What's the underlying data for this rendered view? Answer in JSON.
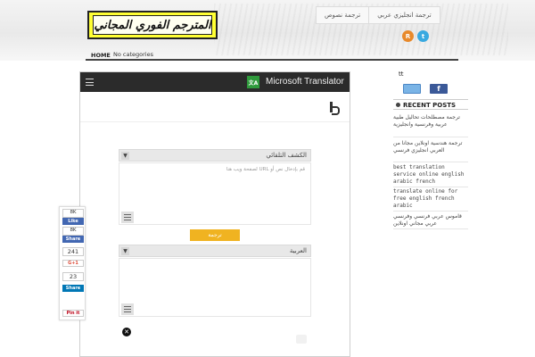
{
  "header": {
    "logo_text": "المترجم الفوري المجاني",
    "nav": [
      "ترجمة نصوص",
      "ترجمة انجليزي عربي"
    ],
    "social": {
      "rss_glyph": "R",
      "twitter_glyph": "t"
    }
  },
  "menu": {
    "home": "HOME",
    "category": "No categories"
  },
  "translator": {
    "title": "Microsoft Translator",
    "source_lang": "الكشف التلقائي",
    "placeholder": "قم بإدخال نص أو URL لصفحة ويب هنا",
    "translate_button": "ترجمة",
    "target_lang": "العربية",
    "close_glyph": "✕"
  },
  "share": {
    "fb_count": "8K",
    "fb_like": "Like",
    "fb_share_count": "8K",
    "fb_share": "Share",
    "gplus_count": "241",
    "gplus": "G+1",
    "linkedin_count": "23",
    "linkedin": "Share",
    "pinterest": "Pin it"
  },
  "sidebar": {
    "top_text": "tt",
    "facebook_glyph": "f",
    "recent_title": "RECENT POSTS",
    "posts": [
      "ترجمة مصطلحات تحاليل طبية عربية وفرنسية وانجليزية",
      "ترجمة هندسية اونلاين مجانا من العربي انجليزي فرنسي",
      "best translation service online english arabic french",
      "translate online for free english french arabic",
      "قاموس عربي فرنسي وفرنسي عربي مجاني اونلاين"
    ]
  },
  "colors": {
    "logo_bg": "#ffff33",
    "translator_bar": "#2b2b2b",
    "translate_button": "#f0b321",
    "facebook": "#3b5998",
    "linkedin": "#0077b5"
  }
}
